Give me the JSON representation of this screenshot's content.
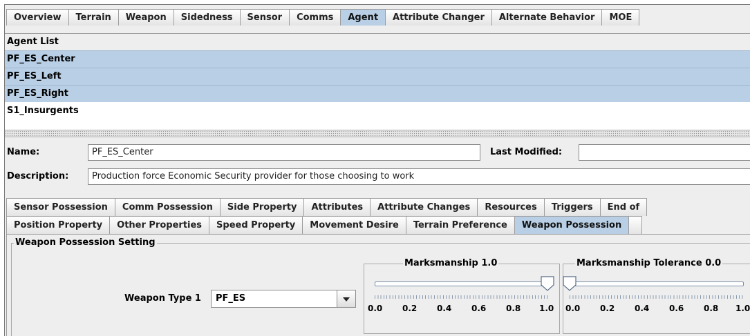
{
  "main_tabs": [
    "Overview",
    "Terrain",
    "Weapon",
    "Sidedness",
    "Sensor",
    "Comms",
    "Agent",
    "Attribute Changer",
    "Alternate Behavior",
    "MOE"
  ],
  "main_active": "Agent",
  "agent_list": {
    "header": "Agent List",
    "items": [
      {
        "label": "PF_ES_Center",
        "selected": true
      },
      {
        "label": "PF_ES_Left",
        "selected": true
      },
      {
        "label": "PF_ES_Right",
        "selected": true
      },
      {
        "label": "S1_Insurgents",
        "selected": false
      }
    ]
  },
  "form": {
    "name_label": "Name:",
    "name_value": "PF_ES_Center",
    "last_modified_label": "Last Modified:",
    "last_modified_value": "",
    "description_label": "Description:",
    "description_value": "Production force Economic Security provider for those choosing to work"
  },
  "sub_tabs_row1": [
    "Sensor Possession",
    "Comm Possession",
    "Side Property",
    "Attributes",
    "Attribute Changes",
    "Resources",
    "Triggers",
    "End of"
  ],
  "sub_tabs_row2": [
    "Position Property",
    "Other Properties",
    "Speed Property",
    "Movement Desire",
    "Terrain Preference",
    "Weapon Possession"
  ],
  "sub_active": "Weapon Possession",
  "weapon": {
    "group_title": "Weapon Possession Setting",
    "type_label": "Weapon Type 1",
    "type_value": "PF_ES",
    "marksmanship_title": "Marksmanship 1.0",
    "marksmanship_value": 1.0,
    "tolerance_title": "Marksmanship Tolerance 0.0",
    "tolerance_value": 0.0,
    "scale": [
      "0.0",
      "0.2",
      "0.4",
      "0.6",
      "0.8",
      "1.0"
    ]
  },
  "colors": {
    "selection": "#b8cfe5",
    "tab_active": "#b8cfe5"
  }
}
